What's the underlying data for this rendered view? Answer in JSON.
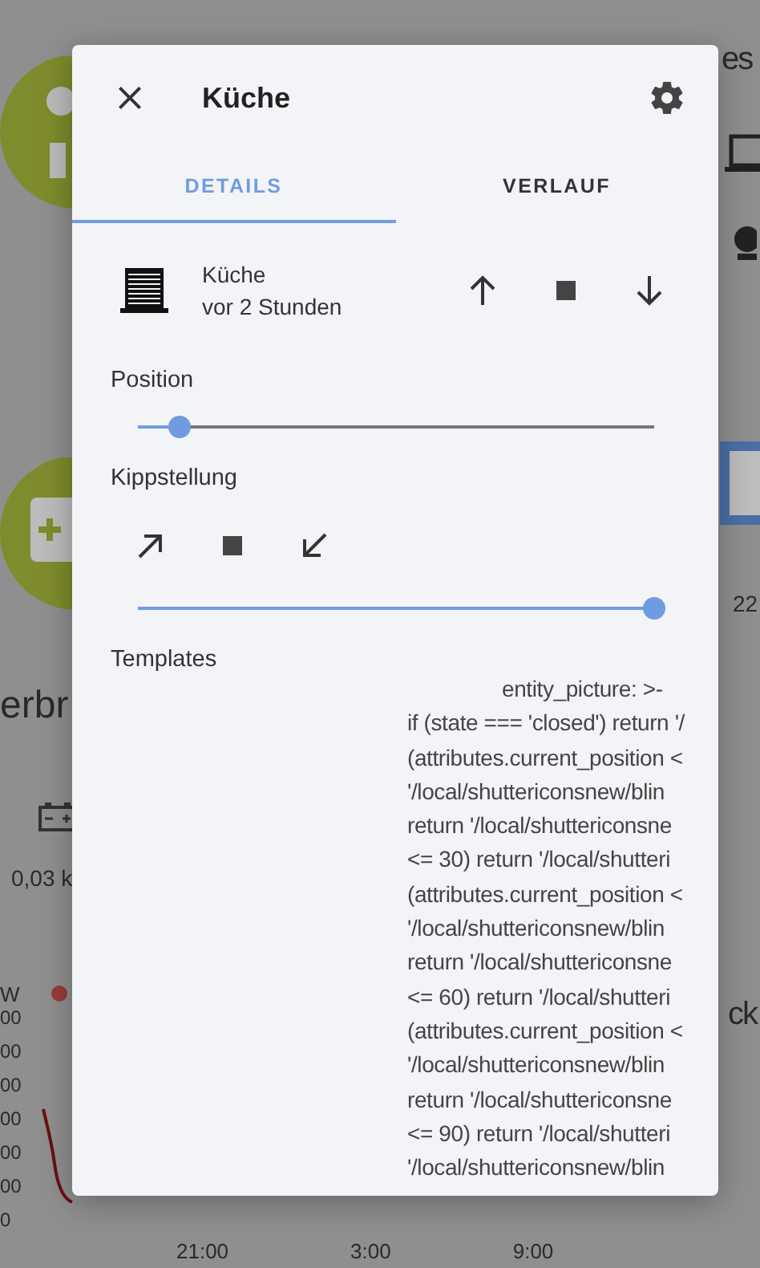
{
  "background": {
    "left_heading": "erbr",
    "energy_value": "0,03 k",
    "chart_unit": "W",
    "chart_y_ticks": [
      "00",
      "00",
      "00",
      "00",
      "00",
      "00",
      "0"
    ],
    "chart_x_ticks": [
      "21:00",
      "3:00",
      "9:00"
    ],
    "right_heading": "es",
    "right_value": "22",
    "right_heading_2": "ck"
  },
  "dialog": {
    "title": "Küche",
    "tabs": [
      {
        "label": "DETAILS",
        "selected": true
      },
      {
        "label": "VERLAUF",
        "selected": false
      }
    ],
    "entity": {
      "name": "Küche",
      "last_changed": "vor 2 Stunden"
    },
    "position": {
      "label": "Position",
      "level": 0.08
    },
    "tilt": {
      "label": "Kippstellung",
      "level": 1.0
    },
    "templates": {
      "label": "Templates",
      "lines": [
        "entity_picture: >-",
        "if (state === 'closed') return '/",
        "(attributes.current_position <",
        "'/local/shuttericonsnew/blin",
        "return '/local/shuttericonsne",
        "<= 30) return '/local/shutteri",
        "(attributes.current_position <",
        "'/local/shuttericonsnew/blin",
        "return '/local/shuttericonsne",
        "<= 60) return '/local/shutteri",
        "(attributes.current_position <",
        "'/local/shuttericonsnew/blin",
        "return '/local/shuttericonsne",
        "<= 90) return '/local/shutteri",
        "'/local/shuttericonsnew/blin"
      ]
    }
  }
}
